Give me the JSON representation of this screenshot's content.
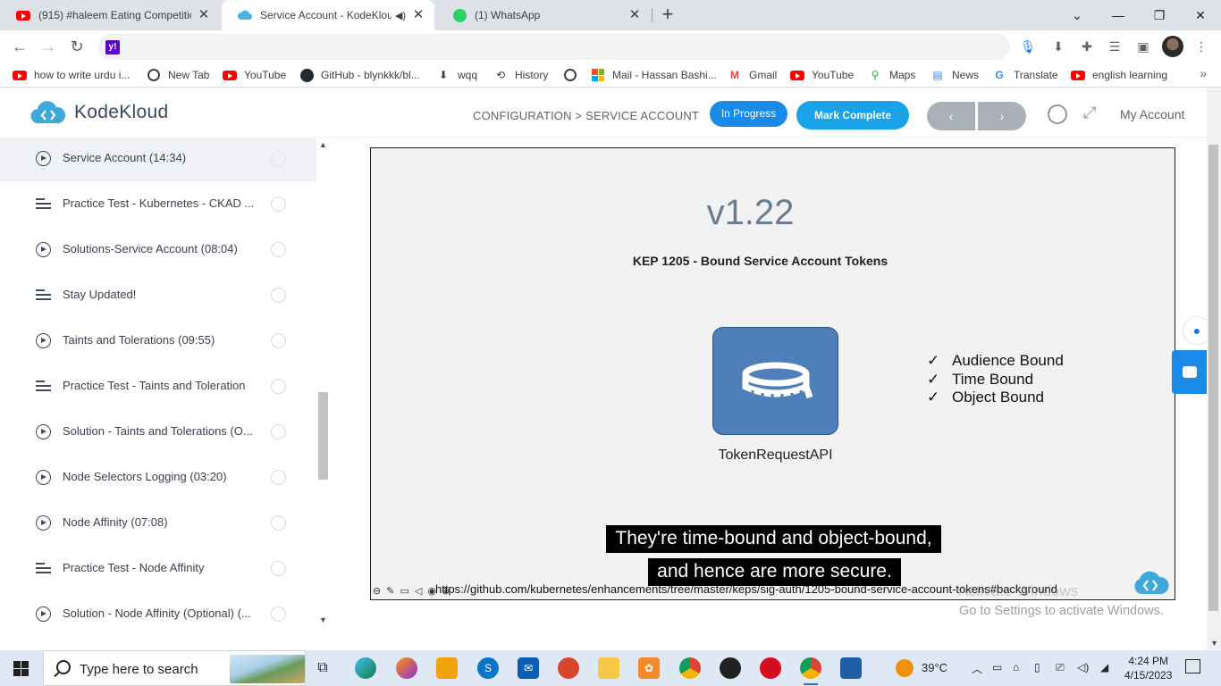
{
  "browser": {
    "tabs": [
      {
        "title": "(915) #haleem Eating Competitio",
        "icon": "youtube-icon",
        "active": false
      },
      {
        "title": "Service Account - KodeKloud",
        "icon": "kodekloud-icon",
        "active": true
      },
      {
        "title": "(1) WhatsApp",
        "icon": "whatsapp-icon",
        "active": false
      }
    ],
    "bookmarks": [
      {
        "label": "how to write urdu i...",
        "icon": "youtube-icon"
      },
      {
        "label": "New Tab",
        "icon": "globe-icon"
      },
      {
        "label": "YouTube",
        "icon": "youtube-icon"
      },
      {
        "label": "GitHub - blynkkk/bl...",
        "icon": "github-icon"
      },
      {
        "label": "wqq",
        "icon": "download-icon"
      },
      {
        "label": "History",
        "icon": "history-icon"
      },
      {
        "label": "",
        "icon": "globe-icon"
      },
      {
        "label": "Mail - Hassan Bashi...",
        "icon": "microsoft-icon"
      },
      {
        "label": "Gmail",
        "icon": "gmail-icon"
      },
      {
        "label": "YouTube",
        "icon": "youtube-icon"
      },
      {
        "label": "Maps",
        "icon": "maps-icon"
      },
      {
        "label": "News",
        "icon": "news-icon"
      },
      {
        "label": "Translate",
        "icon": "translate-icon"
      },
      {
        "label": "english learning",
        "icon": "youtube-icon"
      }
    ]
  },
  "header": {
    "brand": "KodeKloud",
    "breadcrumb": "CONFIGURATION > SERVICE ACCOUNT",
    "status_button": "In Progress",
    "complete_button": "Mark Complete",
    "prev": "‹",
    "next": "›",
    "account": "My Account"
  },
  "sidebar": {
    "items": [
      {
        "label": "Service Account (14:34)",
        "type": "video",
        "current": true
      },
      {
        "label": "Practice Test - Kubernetes - CKAD ...",
        "type": "lab"
      },
      {
        "label": "Solutions-Service Account (08:04)",
        "type": "video"
      },
      {
        "label": "Stay Updated!",
        "type": "lab"
      },
      {
        "label": "Taints and Tolerations (09:55)",
        "type": "video"
      },
      {
        "label": "Practice Test - Taints and Toleration",
        "type": "lab"
      },
      {
        "label": "Solution - Taints and Tolerations (O...",
        "type": "video"
      },
      {
        "label": "Node Selectors Logging (03:20)",
        "type": "video"
      },
      {
        "label": "Node Affinity (07:08)",
        "type": "video"
      },
      {
        "label": "Practice Test - Node Affinity",
        "type": "lab"
      },
      {
        "label": "Solution - Node Affinity (Optional) (...",
        "type": "video"
      }
    ]
  },
  "video": {
    "version": "v1.22",
    "kep_title": "KEP 1205 - Bound Service Account Tokens",
    "api_label": "TokenRequestAPI",
    "checks": [
      "Audience Bound",
      "Time Bound",
      "Object Bound"
    ],
    "check_mark": "✓",
    "subtitle_line1": "They're time-bound and object-bound,",
    "subtitle_line2": "and hence are more secure.",
    "url": "https://github.com/kubernetes/enhancements/tree/master/keps/sig-auth/1205-bound-service-account-tokens#background"
  },
  "watermark": {
    "line1": "Activate Windows",
    "line2": "Go to Settings to activate Windows."
  },
  "taskbar": {
    "search_placeholder": "Type here to search",
    "temperature": "39°C",
    "time": "4:24 PM",
    "date": "4/15/2023"
  }
}
